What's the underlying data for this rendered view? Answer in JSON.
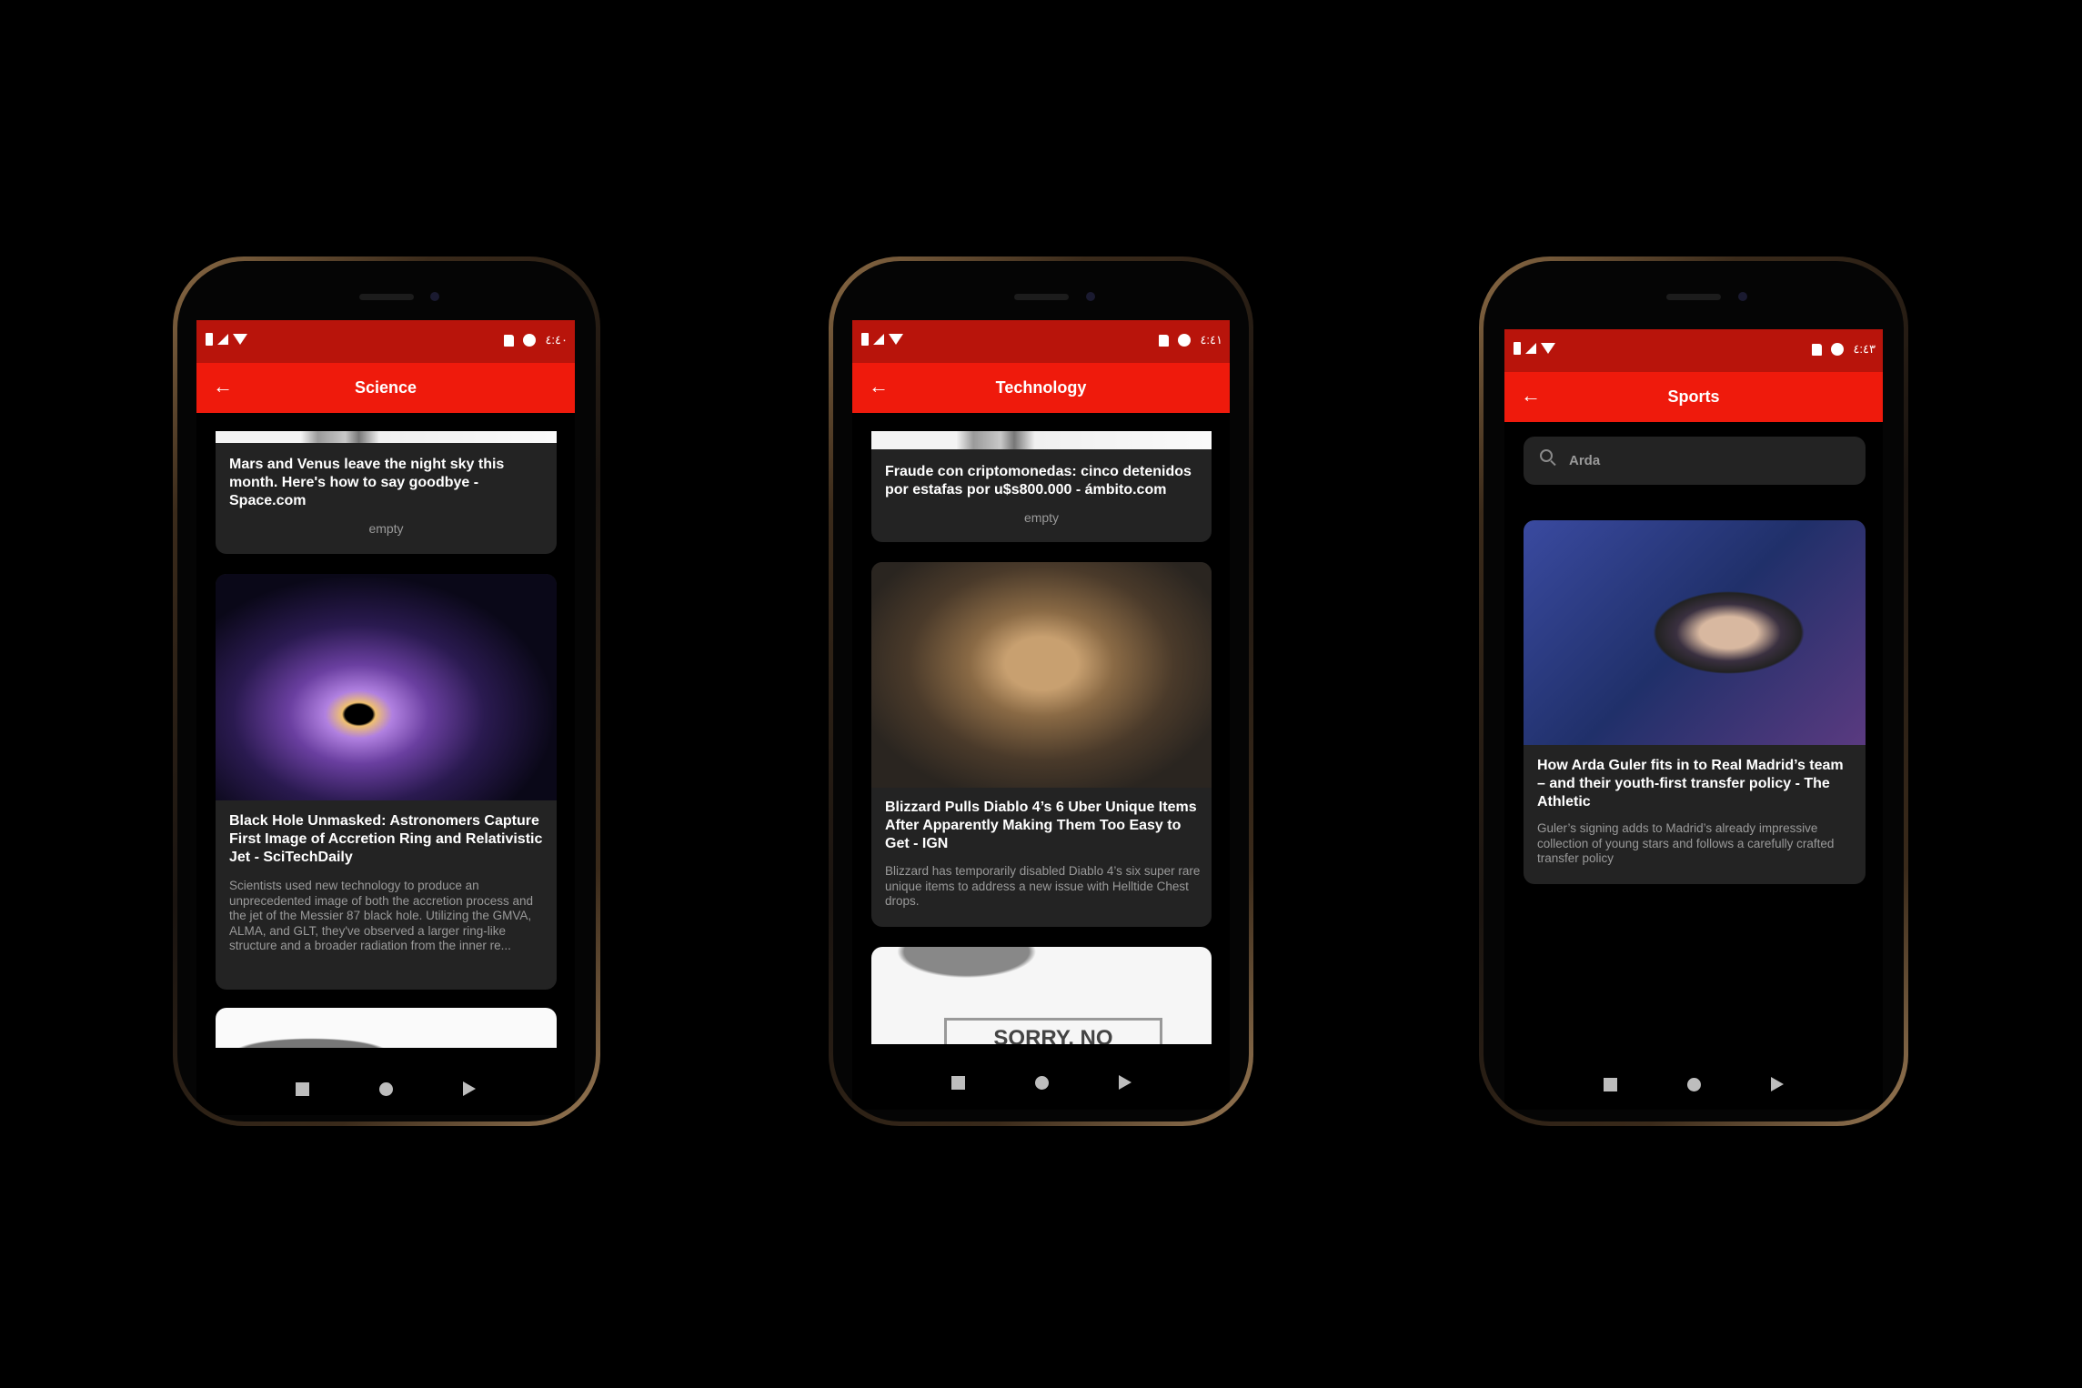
{
  "phones": [
    {
      "status_time": "٤:٤٠",
      "title": "Science",
      "cards": [
        {
          "title": "Mars and Venus leave the night sky this month. Here's how to say goodbye - Space.com",
          "description": "empty"
        },
        {
          "title": "Black Hole Unmasked: Astronomers Capture First Image of Accretion Ring and Relativistic Jet - SciTechDaily",
          "description": "Scientists used new technology to produce an unprecedented image of both the accretion process and the jet of the Messier 87 black hole. Utilizing the GMVA, ALMA, and GLT, they've observed a larger ring-like structure and a broader radiation from the inner re..."
        }
      ]
    },
    {
      "status_time": "٤:٤١",
      "title": "Technology",
      "cards": [
        {
          "title": "Fraude con criptomonedas: cinco detenidos por estafas por u$s800.000 - ámbito.com",
          "description": "empty"
        },
        {
          "title": "Blizzard Pulls Diablo 4’s 6 Uber Unique Items After Apparently Making Them Too Easy to Get - IGN",
          "description": "Blizzard has temporarily disabled Diablo 4’s six super rare unique items to address a new issue with Helltide Chest drops."
        },
        {
          "image_text": "SORRY, NO"
        }
      ]
    },
    {
      "status_time": "٤:٤٣",
      "title": "Sports",
      "search_value": "Arda",
      "cards": [
        {
          "title": "How Arda Guler fits in to Real Madrid’s team – and their youth-first transfer policy - The Athletic",
          "description": "Guler’s signing adds to Madrid’s already impressive collection of young stars and follows a carefully crafted transfer policy"
        }
      ]
    }
  ],
  "colors": {
    "status_bar": "#b8140b",
    "app_bar": "#ef1a0c",
    "card": "#232323"
  }
}
